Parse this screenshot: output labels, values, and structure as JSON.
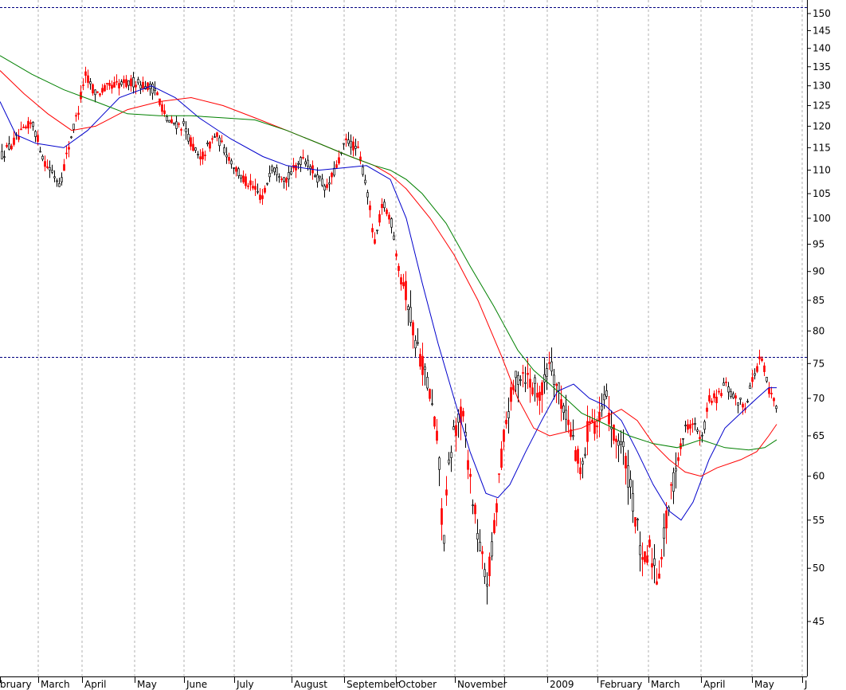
{
  "chart_data": {
    "type": "candlestick",
    "title": "",
    "xlabel": "",
    "ylabel": "",
    "y_scale": "log",
    "ylim": [
      41,
      152
    ],
    "grid": true,
    "yticks": [
      45,
      50,
      55,
      60,
      65,
      70,
      75,
      80,
      85,
      90,
      95,
      100,
      105,
      110,
      115,
      120,
      125,
      130,
      135,
      140,
      145,
      150
    ],
    "months": [
      {
        "label": "bruary"
      },
      {
        "label": "March"
      },
      {
        "label": "April"
      },
      {
        "label": "May"
      },
      {
        "label": "June"
      },
      {
        "label": "July"
      },
      {
        "label": "August"
      },
      {
        "label": "September"
      },
      {
        "label": "October"
      },
      {
        "label": "November"
      },
      {
        "label": ""
      },
      {
        "label": "2009"
      },
      {
        "label": "February"
      },
      {
        "label": "March"
      },
      {
        "label": "April"
      },
      {
        "label": "May"
      },
      {
        "label": "J"
      }
    ],
    "reference_lines": [
      152,
      76
    ],
    "colors": {
      "up": "#000000",
      "down": "#ff0000",
      "grid": "#b0b0b0",
      "ref": "#000080"
    },
    "series": [
      {
        "color": "#0000cc",
        "points": [
          [
            0,
            126
          ],
          [
            20,
            118
          ],
          [
            45,
            116
          ],
          [
            80,
            115
          ],
          [
            110,
            119
          ],
          [
            150,
            127
          ],
          [
            190,
            130
          ],
          [
            220,
            127
          ],
          [
            250,
            122
          ],
          [
            290,
            117
          ],
          [
            330,
            113
          ],
          [
            360,
            111
          ],
          [
            400,
            110
          ],
          [
            430,
            110.5
          ],
          [
            460,
            111
          ],
          [
            490,
            108
          ],
          [
            510,
            100
          ],
          [
            530,
            88
          ],
          [
            550,
            78
          ],
          [
            570,
            70
          ],
          [
            590,
            63
          ],
          [
            610,
            58
          ],
          [
            625,
            57.5
          ],
          [
            640,
            59
          ],
          [
            660,
            63
          ],
          [
            680,
            67
          ],
          [
            700,
            71
          ],
          [
            720,
            72
          ],
          [
            740,
            70
          ],
          [
            760,
            69
          ],
          [
            780,
            67
          ],
          [
            800,
            63
          ],
          [
            820,
            59
          ],
          [
            840,
            56
          ],
          [
            855,
            55
          ],
          [
            870,
            57
          ],
          [
            890,
            62
          ],
          [
            910,
            66
          ],
          [
            930,
            68
          ],
          [
            950,
            70
          ],
          [
            965,
            71.5
          ],
          [
            975,
            71.5
          ]
        ]
      },
      {
        "color": "#ff0000",
        "points": [
          [
            0,
            134
          ],
          [
            30,
            128
          ],
          [
            60,
            123
          ],
          [
            90,
            119
          ],
          [
            120,
            120
          ],
          [
            160,
            124
          ],
          [
            200,
            126
          ],
          [
            240,
            127
          ],
          [
            280,
            125
          ],
          [
            320,
            122
          ],
          [
            360,
            119
          ],
          [
            400,
            116
          ],
          [
            440,
            113
          ],
          [
            470,
            111
          ],
          [
            490,
            109
          ],
          [
            510,
            106
          ],
          [
            540,
            100
          ],
          [
            570,
            93
          ],
          [
            600,
            85
          ],
          [
            630,
            76
          ],
          [
            650,
            70
          ],
          [
            670,
            66
          ],
          [
            690,
            65
          ],
          [
            710,
            65.5
          ],
          [
            730,
            66
          ],
          [
            760,
            67.5
          ],
          [
            780,
            68.5
          ],
          [
            800,
            67
          ],
          [
            820,
            64
          ],
          [
            840,
            62
          ],
          [
            860,
            60.5
          ],
          [
            880,
            60
          ],
          [
            900,
            61
          ],
          [
            930,
            62
          ],
          [
            950,
            63
          ],
          [
            965,
            65
          ],
          [
            975,
            66.5
          ]
        ]
      },
      {
        "color": "#008000",
        "points": [
          [
            0,
            138
          ],
          [
            40,
            133
          ],
          [
            80,
            129
          ],
          [
            120,
            126
          ],
          [
            160,
            123
          ],
          [
            200,
            122.5
          ],
          [
            240,
            122.5
          ],
          [
            280,
            122
          ],
          [
            320,
            121.5
          ],
          [
            360,
            119
          ],
          [
            400,
            116
          ],
          [
            440,
            113
          ],
          [
            470,
            111
          ],
          [
            490,
            110
          ],
          [
            510,
            108
          ],
          [
            530,
            105
          ],
          [
            560,
            99
          ],
          [
            590,
            91
          ],
          [
            620,
            84
          ],
          [
            650,
            77
          ],
          [
            670,
            74
          ],
          [
            690,
            72
          ],
          [
            710,
            70
          ],
          [
            730,
            68
          ],
          [
            760,
            66.5
          ],
          [
            790,
            65
          ],
          [
            820,
            64
          ],
          [
            850,
            63.5
          ],
          [
            880,
            64.5
          ],
          [
            910,
            63.5
          ],
          [
            940,
            63.2
          ],
          [
            960,
            63.5
          ],
          [
            975,
            64.5
          ]
        ]
      }
    ]
  }
}
